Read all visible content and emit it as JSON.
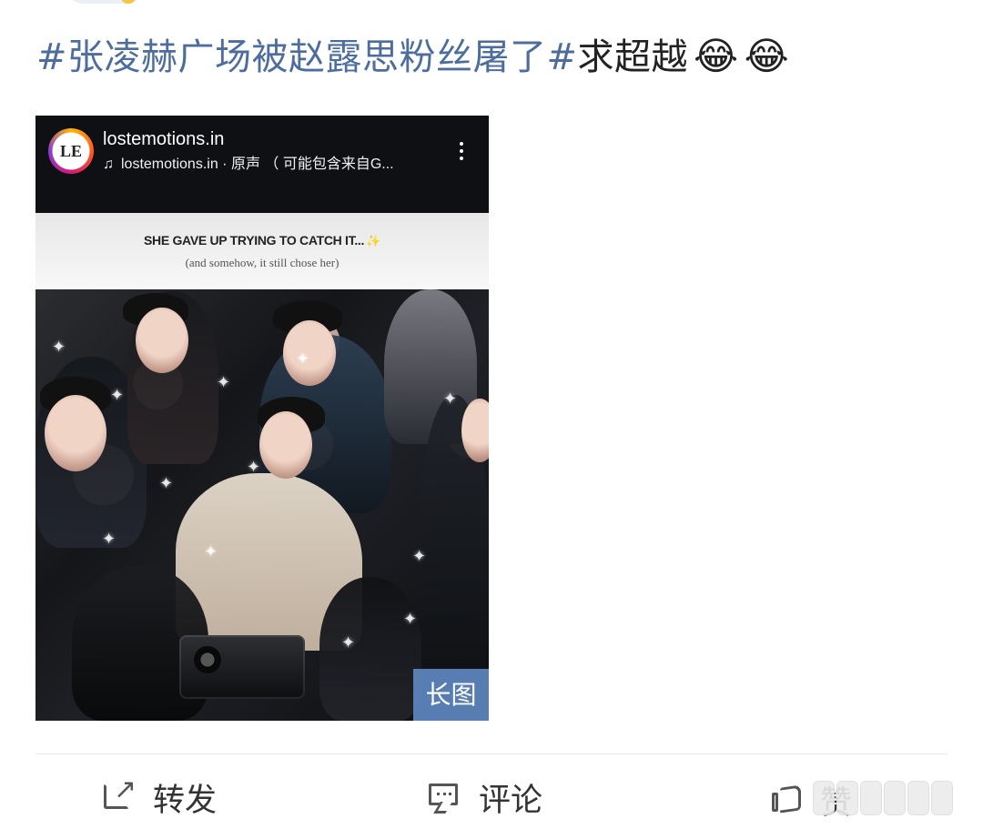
{
  "post": {
    "topic_one": "#张凌赫广场被赵露思粉丝屠了#",
    "plain_text": "求超越",
    "emoji_one": "😂",
    "emoji_two": "😂"
  },
  "media": {
    "account_avatar_text": "LE",
    "account_name": "lostemotions.in",
    "audio_icon": "♫",
    "audio_text": "lostemotions.in · 原声 （ 可能包含来自G...",
    "caption_title": "SHE GAVE UP TRYING TO CATCH IT...",
    "caption_sparkle": "✨",
    "caption_subtitle": "(and somehow, it still chose her)",
    "badge": "长图"
  },
  "actions": {
    "repost_label": "转发",
    "comment_label": "评论",
    "like_label": "赞"
  },
  "icons": {
    "repost": "repost-icon",
    "comment": "comment-icon",
    "like": "thumb-up-icon",
    "more": "more-vertical-icon",
    "music": "music-note-icon"
  },
  "colors": {
    "topic": "#4d6d9e",
    "badge": "#5c84ba",
    "divider": "#e8e8e8"
  }
}
